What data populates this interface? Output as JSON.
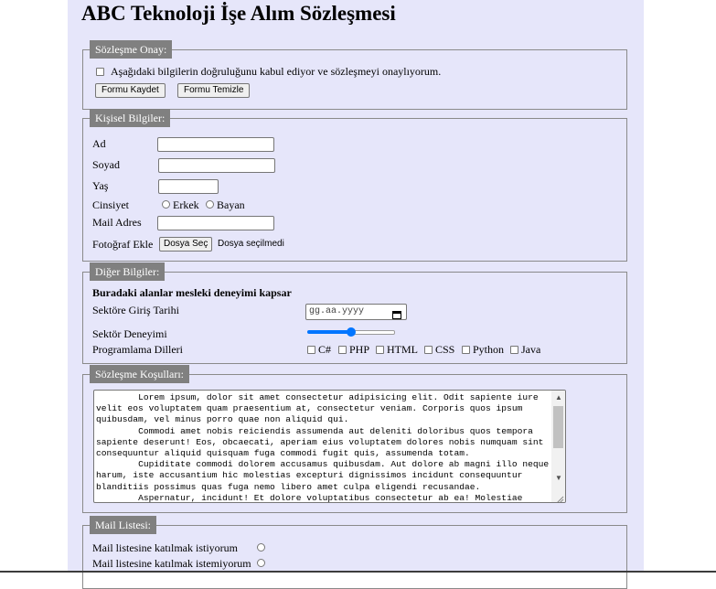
{
  "page_title": "ABC Teknoloji İşe Alım Sözleşmesi",
  "onay": {
    "legend": "Sözleşme Onay:",
    "checkbox_label": "Aşağıdaki bilgilerin doğruluğunu kabul ediyor ve sözleşmeyi onaylıyorum.",
    "save_button": "Formu Kaydet",
    "clear_button": "Formu Temizle"
  },
  "kisisel": {
    "legend": "Kişisel Bilgiler:",
    "ad_label": "Ad",
    "soyad_label": "Soyad",
    "yas_label": "Yaş",
    "cinsiyet_label": "Cinsiyet",
    "erkek_label": "Erkek",
    "bayan_label": "Bayan",
    "mail_label": "Mail Adres",
    "foto_label": "Fotoğraf Ekle",
    "file_button": "Dosya Seç",
    "file_status": "Dosya seçilmedi"
  },
  "diger": {
    "legend": "Diğer Bilgiler:",
    "intro": "Buradaki alanlar mesleki deneyimi kapsar",
    "giris_label": "Sektöre Giriş Tarihi",
    "date_placeholder": "gg.aa.yyyy",
    "deneyim_label": "Sektör Deneyimi",
    "deneyim_value": 0.5,
    "diller_label": "Programlama Dilleri",
    "languages": [
      "C#",
      "PHP",
      "HTML",
      "CSS",
      "Python",
      "Java"
    ]
  },
  "kosullar": {
    "legend": "Sözleşme Koşulları:",
    "text": "        Lorem ipsum, dolor sit amet consectetur adipisicing elit. Odit sapiente iure velit eos voluptatem quam praesentium at, consectetur veniam. Corporis quos ipsum quibusdam, vel minus porro quae non aliquid qui.\n        Commodi amet nobis reiciendis assumenda aut deleniti doloribus quos tempora sapiente deserunt! Eos, obcaecati, aperiam eius voluptatem dolores nobis numquam sint consequuntur aliquid quisquam fuga commodi fugit quis, assumenda totam.\n        Cupiditate commodi dolorem accusamus quibusdam. Aut dolore ab magni illo neque harum, iste accusantium hic molestias excepturi dignissimos incidunt consequuntur blanditiis possimus quas fuga nemo libero amet culpa eligendi recusandae.\n        Aspernatur, incidunt! Et dolore voluptatibus consectetur ab ea! Molestiae"
  },
  "mail": {
    "legend": "Mail Listesi:",
    "option_yes": "Mail listesine katılmak istiyorum",
    "option_no": "Mail listesine katılmak istemiyorum"
  }
}
